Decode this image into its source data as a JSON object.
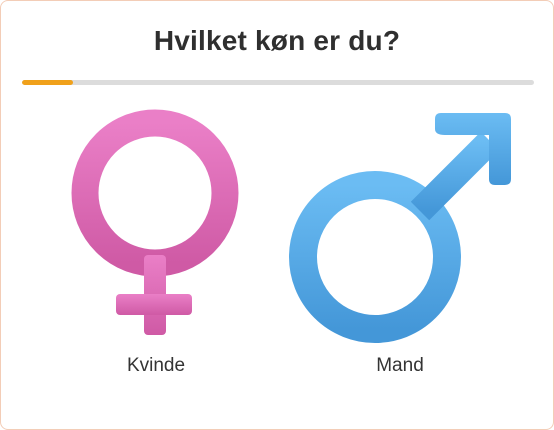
{
  "question": {
    "title": "Hvilket køn er du?"
  },
  "progress": {
    "fraction": 0.1,
    "track_color": "#dcdcdc",
    "fill_color": "#f0a11b"
  },
  "options": [
    {
      "label": "Kvinde",
      "icon": "female-symbol-icon",
      "color_top": "#ea7fc7",
      "color_bottom": "#cf5aa5"
    },
    {
      "label": "Mand",
      "icon": "male-symbol-icon",
      "color_top": "#6bbcf3",
      "color_bottom": "#4497d8"
    }
  ]
}
